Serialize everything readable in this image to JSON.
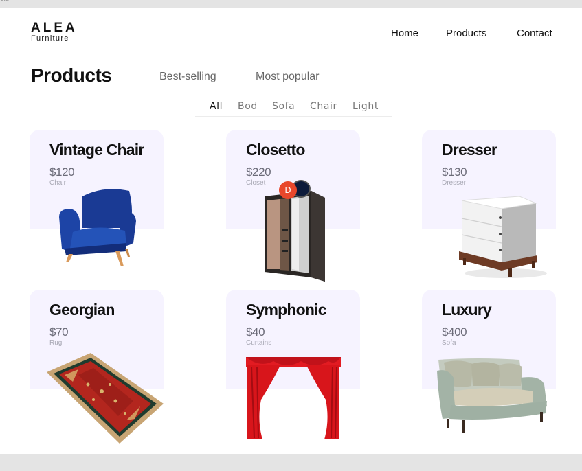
{
  "window": {
    "top_text": "cts"
  },
  "brand": {
    "name": "ALEA",
    "tagline": "Furniture"
  },
  "nav": {
    "home": "Home",
    "products": "Products",
    "contact": "Contact"
  },
  "page": {
    "title": "Products",
    "best_selling": "Best-selling",
    "most_popular": "Most popular"
  },
  "filters": [
    "All",
    "Bod",
    "Sofa",
    "Chair",
    "Light"
  ],
  "products": [
    {
      "name": "Vintage Chair",
      "price": "$120",
      "category": "Chair",
      "icon": "armchair-icon"
    },
    {
      "name": "Closetto",
      "price": "$220",
      "category": "Closet",
      "icon": "wardrobe-icon"
    },
    {
      "name": "Dresser",
      "price": "$130",
      "category": "Dresser",
      "icon": "dresser-icon"
    },
    {
      "name": "Georgian",
      "price": "$70",
      "category": "Rug",
      "icon": "rug-icon"
    },
    {
      "name": "Symphonic",
      "price": "$40",
      "category": "Curtains",
      "icon": "curtains-icon"
    },
    {
      "name": "Luxury",
      "price": "$400",
      "category": "Sofa",
      "icon": "sofa-icon"
    }
  ],
  "overlay": {
    "avatar_letter": "D"
  },
  "colors": {
    "card_bg": "#f6f3ff",
    "avatar": "#e8472b",
    "chair_blue": "#1c3f9c",
    "curtain_red": "#d8151b",
    "rug_red": "#b3261e",
    "sofa_green": "#a9b8ac"
  }
}
